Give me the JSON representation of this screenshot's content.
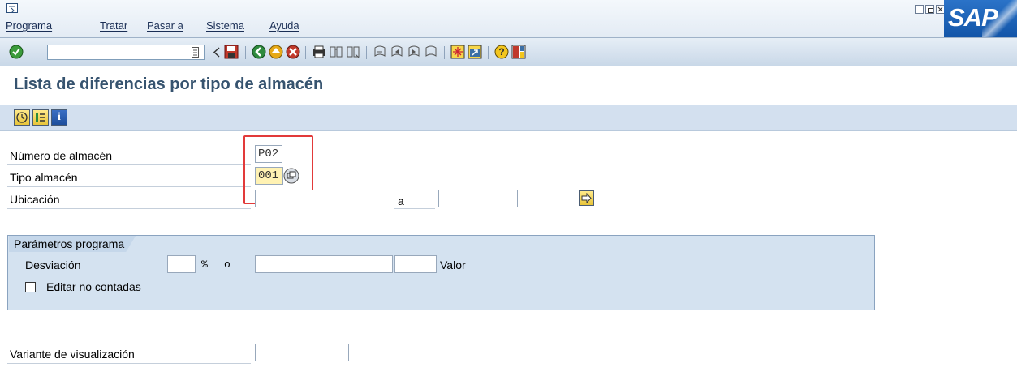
{
  "menubar": {
    "items": [
      "Programa",
      "Tratar",
      "Pasar a",
      "Sistema",
      "Ayuda"
    ]
  },
  "logo_text": "SAP",
  "toolbar": {
    "icons": [
      "enter-icon",
      "back-icon",
      "save-icon",
      "back-green-icon",
      "exit-icon",
      "cancel-icon",
      "print-icon",
      "find-icon",
      "find-next-icon",
      "first-page-icon",
      "prev-page-icon",
      "next-page-icon",
      "last-page-icon",
      "new-session-icon",
      "shortcut-icon",
      "help-icon",
      "layout-icon"
    ]
  },
  "page": {
    "title": "Lista de diferencias por tipo de almacén"
  },
  "app_toolbar": {
    "icons": [
      "execute-icon",
      "selection-options-icon",
      "info-icon"
    ]
  },
  "form": {
    "numero_almacen": {
      "label": "Número de almacén",
      "value": "P02"
    },
    "tipo_almacen": {
      "label": "Tipo almacén",
      "value": "001"
    },
    "ubicacion": {
      "label": "Ubicación",
      "from": "",
      "to_label": "a",
      "to": ""
    },
    "group": {
      "title": "Parámetros programa",
      "desviacion": {
        "label": "Desviación",
        "percent_value": "",
        "percent_sign": "%",
        "or_label": "o",
        "amount": "",
        "currency": "",
        "valor_label": "Valor"
      },
      "editar_no_contadas": {
        "label": "Editar no contadas",
        "checked": false
      }
    },
    "variante": {
      "label": "Variante de visualización",
      "value": ""
    }
  }
}
